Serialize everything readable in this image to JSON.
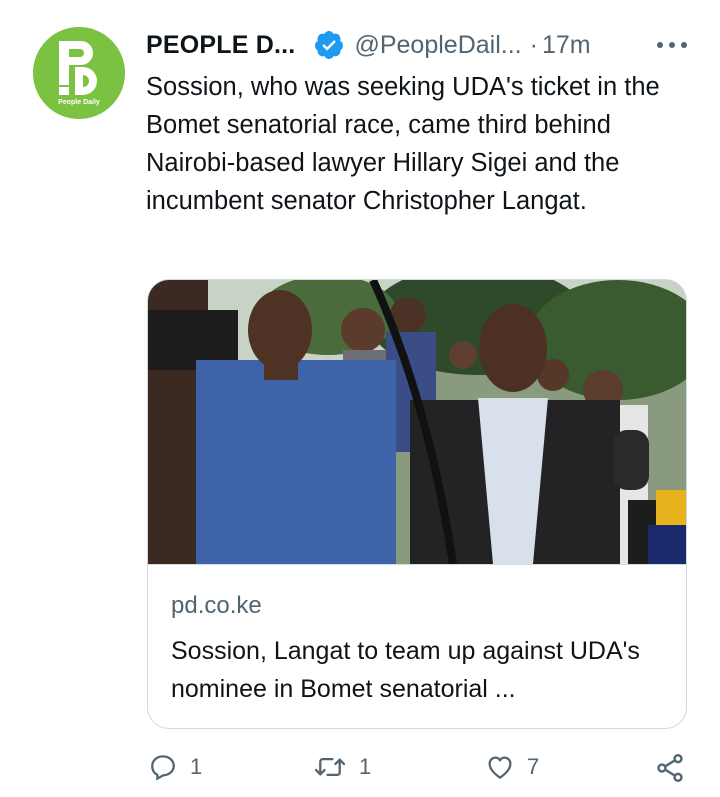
{
  "author": {
    "display_name": "PEOPLE D...",
    "handle": "@PeopleDail...",
    "separator": "·",
    "time": "17m",
    "verified": true,
    "avatar_brand": "People Daily",
    "avatar_color": "#7cc242"
  },
  "tweet": {
    "text": "Sossion, who was seeking UDA's ticket in the Bomet senatorial race, came third behind Nairobi-based lawyer Hillary Sigei and the incumbent senator Christopher Langat."
  },
  "link_card": {
    "domain": "pd.co.ke",
    "title": "Sossion, Langat to team up against UDA's nominee in Bomet senatorial ..."
  },
  "actions": {
    "reply_count": "1",
    "retweet_count": "1",
    "like_count": "7"
  },
  "colors": {
    "text": "#0f1419",
    "secondary": "#536471",
    "verified": "#1d9bf0",
    "border": "#cfd9de"
  }
}
